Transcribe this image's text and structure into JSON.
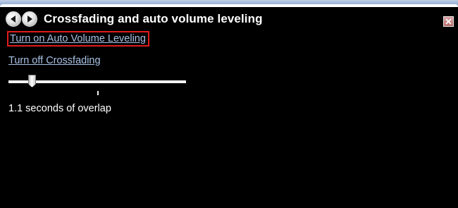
{
  "window": {
    "title": "Crossfading and auto volume leveling",
    "back_icon": "back-arrow-icon",
    "forward_icon": "forward-arrow-icon",
    "close_icon": "close-icon",
    "colors": {
      "background": "#000000",
      "link": "#a9c2e6",
      "highlight_border": "#e01b1b",
      "close_button": "#c07b7b"
    }
  },
  "links": {
    "auto_volume": "Turn on Auto Volume Leveling",
    "crossfading": "Turn off Crossfading"
  },
  "slider": {
    "fraction": 0.13,
    "default_mark_fraction": 0.5
  },
  "status": {
    "overlap_text": "1.1 seconds of overlap"
  }
}
